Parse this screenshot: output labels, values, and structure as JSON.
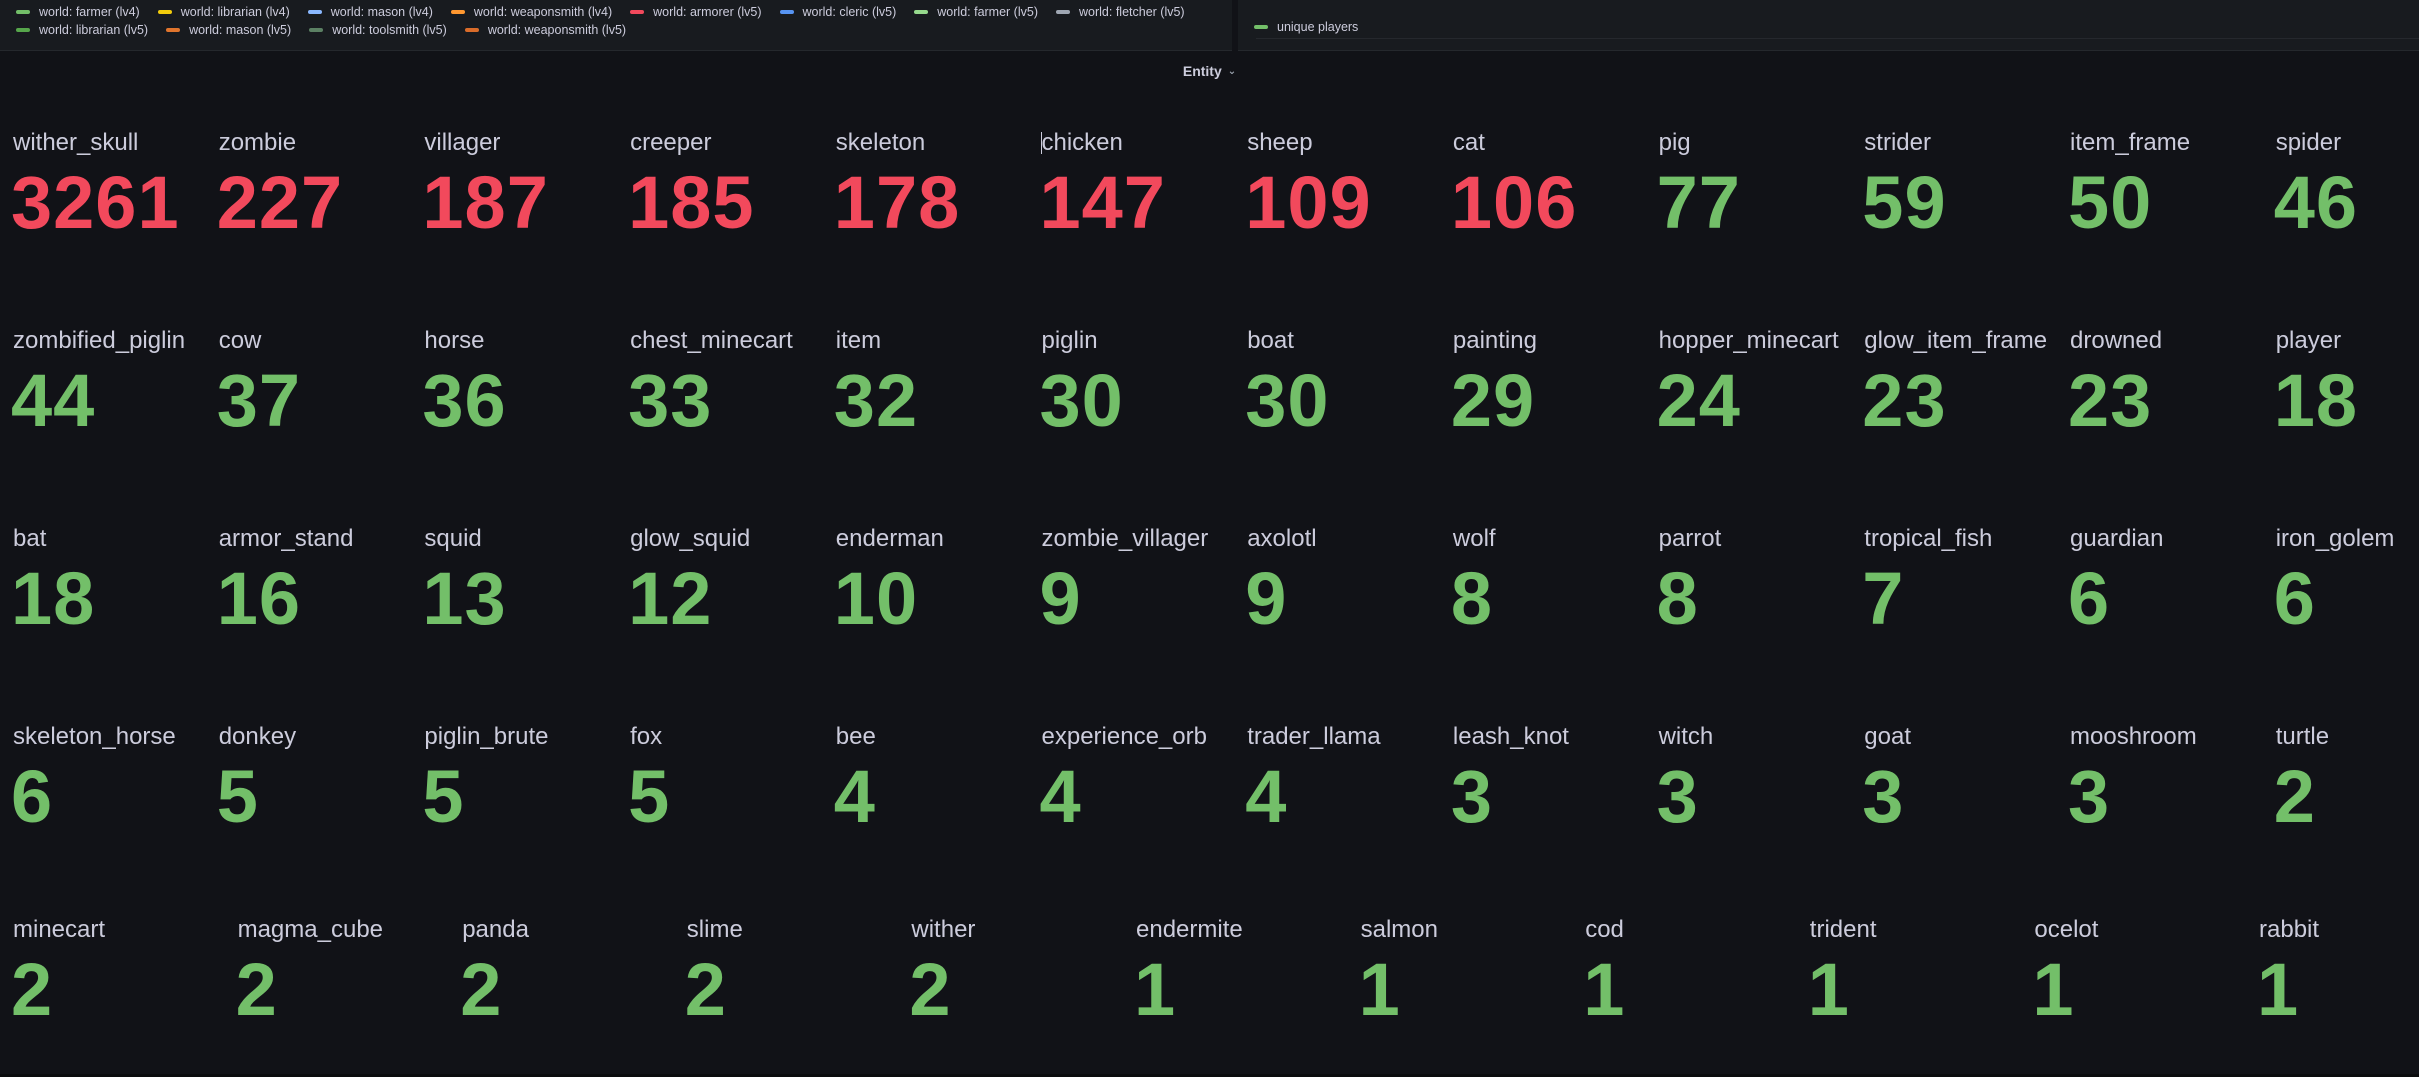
{
  "legend": {
    "row1": [
      {
        "label": "world: farmer (lv4)",
        "color": "#73bf69"
      },
      {
        "label": "world: librarian (lv4)",
        "color": "#f2cc0c"
      },
      {
        "label": "world: mason (lv4)",
        "color": "#8ab8ff"
      },
      {
        "label": "world: weaponsmith (lv4)",
        "color": "#ff9830"
      },
      {
        "label": "world: armorer (lv5)",
        "color": "#f2495c"
      },
      {
        "label": "world: cleric (lv5)",
        "color": "#5794f2"
      },
      {
        "label": "world: farmer (lv5)",
        "color": "#96d98d"
      },
      {
        "label": "world: fletcher (lv5)",
        "color": "#9fa7b3"
      }
    ],
    "row2": [
      {
        "label": "world: librarian (lv5)",
        "color": "#56a64b"
      },
      {
        "label": "world: mason (lv5)",
        "color": "#e0752d"
      },
      {
        "label": "world: toolsmith (lv5)",
        "color": "#5b8063"
      },
      {
        "label": "world: weaponsmith (lv5)",
        "color": "#d96c2a"
      }
    ]
  },
  "players_legend": {
    "label": "unique players",
    "color": "#73bf69"
  },
  "row_header": {
    "title": "Entity",
    "chevron": "⌄"
  },
  "colors": {
    "high": "#f2495c",
    "normal": "#73bf69"
  },
  "stats": [
    [
      {
        "name": "wither_skull",
        "value": "3261",
        "status": "high"
      },
      {
        "name": "zombie",
        "value": "227",
        "status": "high"
      },
      {
        "name": "villager",
        "value": "187",
        "status": "high"
      },
      {
        "name": "creeper",
        "value": "185",
        "status": "high"
      },
      {
        "name": "skeleton",
        "value": "178",
        "status": "high"
      },
      {
        "name": "chicken",
        "value": "147",
        "status": "high"
      },
      {
        "name": "sheep",
        "value": "109",
        "status": "high"
      },
      {
        "name": "cat",
        "value": "106",
        "status": "high"
      },
      {
        "name": "pig",
        "value": "77",
        "status": "normal"
      },
      {
        "name": "strider",
        "value": "59",
        "status": "normal"
      },
      {
        "name": "item_frame",
        "value": "50",
        "status": "normal"
      },
      {
        "name": "spider",
        "value": "46",
        "status": "normal"
      }
    ],
    [
      {
        "name": "zombified_piglin",
        "value": "44",
        "status": "normal"
      },
      {
        "name": "cow",
        "value": "37",
        "status": "normal"
      },
      {
        "name": "horse",
        "value": "36",
        "status": "normal"
      },
      {
        "name": "chest_minecart",
        "value": "33",
        "status": "normal"
      },
      {
        "name": "item",
        "value": "32",
        "status": "normal"
      },
      {
        "name": "piglin",
        "value": "30",
        "status": "normal"
      },
      {
        "name": "boat",
        "value": "30",
        "status": "normal"
      },
      {
        "name": "painting",
        "value": "29",
        "status": "normal"
      },
      {
        "name": "hopper_minecart",
        "value": "24",
        "status": "normal"
      },
      {
        "name": "glow_item_frame",
        "value": "23",
        "status": "normal"
      },
      {
        "name": "drowned",
        "value": "23",
        "status": "normal"
      },
      {
        "name": "player",
        "value": "18",
        "status": "normal"
      }
    ],
    [
      {
        "name": "bat",
        "value": "18",
        "status": "normal"
      },
      {
        "name": "armor_stand",
        "value": "16",
        "status": "normal"
      },
      {
        "name": "squid",
        "value": "13",
        "status": "normal"
      },
      {
        "name": "glow_squid",
        "value": "12",
        "status": "normal"
      },
      {
        "name": "enderman",
        "value": "10",
        "status": "normal"
      },
      {
        "name": "zombie_villager",
        "value": "9",
        "status": "normal"
      },
      {
        "name": "axolotl",
        "value": "9",
        "status": "normal"
      },
      {
        "name": "wolf",
        "value": "8",
        "status": "normal"
      },
      {
        "name": "parrot",
        "value": "8",
        "status": "normal"
      },
      {
        "name": "tropical_fish",
        "value": "7",
        "status": "normal"
      },
      {
        "name": "guardian",
        "value": "6",
        "status": "normal"
      },
      {
        "name": "iron_golem",
        "value": "6",
        "status": "normal"
      }
    ],
    [
      {
        "name": "skeleton_horse",
        "value": "6",
        "status": "normal"
      },
      {
        "name": "donkey",
        "value": "5",
        "status": "normal"
      },
      {
        "name": "piglin_brute",
        "value": "5",
        "status": "normal"
      },
      {
        "name": "fox",
        "value": "5",
        "status": "normal"
      },
      {
        "name": "bee",
        "value": "4",
        "status": "normal"
      },
      {
        "name": "experience_orb",
        "value": "4",
        "status": "normal"
      },
      {
        "name": "trader_llama",
        "value": "4",
        "status": "normal"
      },
      {
        "name": "leash_knot",
        "value": "3",
        "status": "normal"
      },
      {
        "name": "witch",
        "value": "3",
        "status": "normal"
      },
      {
        "name": "goat",
        "value": "3",
        "status": "normal"
      },
      {
        "name": "mooshroom",
        "value": "3",
        "status": "normal"
      },
      {
        "name": "turtle",
        "value": "2",
        "status": "normal"
      }
    ],
    [
      {
        "name": "minecart",
        "value": "2",
        "status": "normal"
      },
      {
        "name": "magma_cube",
        "value": "2",
        "status": "normal"
      },
      {
        "name": "panda",
        "value": "2",
        "status": "normal"
      },
      {
        "name": "slime",
        "value": "2",
        "status": "normal"
      },
      {
        "name": "wither",
        "value": "2",
        "status": "normal"
      },
      {
        "name": "endermite",
        "value": "1",
        "status": "normal"
      },
      {
        "name": "salmon",
        "value": "1",
        "status": "normal"
      },
      {
        "name": "cod",
        "value": "1",
        "status": "normal"
      },
      {
        "name": "trident",
        "value": "1",
        "status": "normal"
      },
      {
        "name": "ocelot",
        "value": "1",
        "status": "normal"
      },
      {
        "name": "rabbit",
        "value": "1",
        "status": "normal"
      }
    ]
  ]
}
